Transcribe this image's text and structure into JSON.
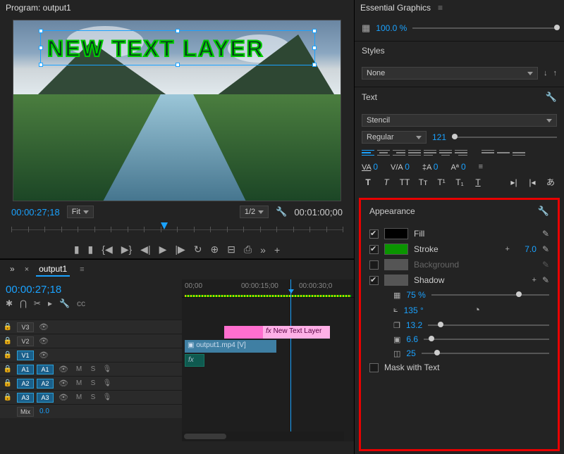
{
  "program": {
    "title": "Program: output1",
    "overlay_text": "NEW TEXT LAYER",
    "timecode_current": "00:00:27;18",
    "fit_label": "Fit",
    "res_label": "1/2",
    "timecode_total": "00:01:00;00"
  },
  "timeline": {
    "tab_name": "output1",
    "timecode": "00:00:27;18",
    "time_marks": [
      "00;00",
      "00:00:15;00",
      "00:00:30;0"
    ],
    "tracks": [
      {
        "tag": "V3",
        "selected": false,
        "type": "v"
      },
      {
        "tag": "V2",
        "selected": false,
        "type": "v"
      },
      {
        "tag": "V1",
        "selected": true,
        "type": "v"
      },
      {
        "tag": "A1",
        "selected": true,
        "type": "a"
      },
      {
        "tag": "A2",
        "selected": true,
        "type": "a"
      },
      {
        "tag": "A3",
        "selected": true,
        "type": "a"
      }
    ],
    "mix_label": "Mix",
    "mix_value": "0.0",
    "clips": {
      "v2_text": "New Text Layer",
      "v1": "output1.mp4 [V]",
      "fx_label": "fx"
    }
  },
  "right": {
    "panel_title": "Essential Graphics",
    "opacity": "100.0 %",
    "styles_head": "Styles",
    "styles_value": "None",
    "text_head": "Text",
    "font_family": "Stencil",
    "font_weight": "Regular",
    "font_size": "121",
    "kerning": "0",
    "tracking": "0",
    "baseline": "0",
    "leading": "0",
    "appearance_head": "Appearance",
    "fill_label": "Fill",
    "stroke_label": "Stroke",
    "stroke_value": "7.0",
    "bg_label": "Background",
    "shadow_label": "Shadow",
    "shadow_opacity": "75 %",
    "shadow_angle": "135 °",
    "shadow_distance": "13.2",
    "shadow_size": "6.6",
    "shadow_blur": "25",
    "mask_label": "Mask with Text",
    "ss_label": "S S"
  }
}
